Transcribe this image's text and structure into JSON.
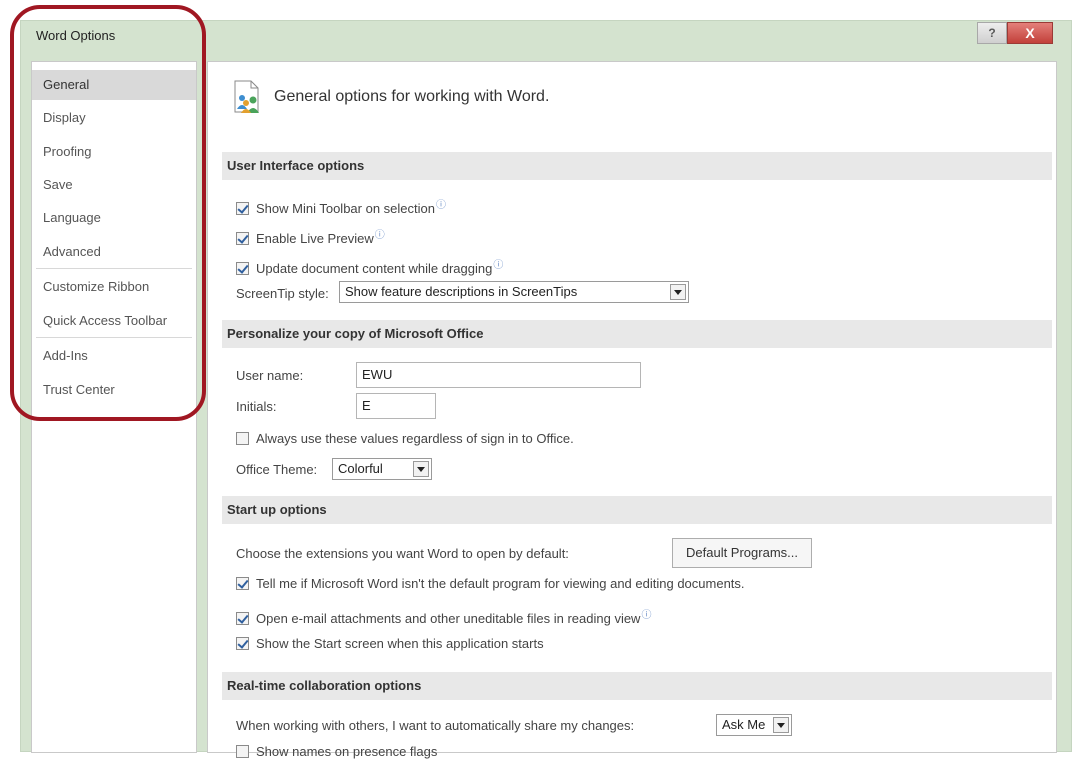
{
  "window": {
    "title": "Word Options",
    "help_glyph": "?",
    "close_glyph": "X"
  },
  "nav": {
    "items": [
      {
        "label": "General",
        "selected": true
      },
      {
        "label": "Display"
      },
      {
        "label": "Proofing"
      },
      {
        "label": "Save"
      },
      {
        "label": "Language"
      },
      {
        "label": "Advanced"
      },
      {
        "label": "Customize Ribbon"
      },
      {
        "label": "Quick Access Toolbar"
      },
      {
        "label": "Add-Ins"
      },
      {
        "label": "Trust Center"
      }
    ]
  },
  "page": {
    "title": "General options for working with Word."
  },
  "ui_options": {
    "heading": "User Interface options",
    "mini_toolbar": {
      "label": "Show Mini Toolbar on selection",
      "checked": true
    },
    "live_preview": {
      "label": "Enable Live Preview",
      "checked": true
    },
    "update_dragging": {
      "label": "Update document content while dragging",
      "checked": true
    },
    "screentip_label": "ScreenTip style:",
    "screentip_value": "Show feature descriptions in ScreenTips"
  },
  "personalize": {
    "heading": "Personalize your copy of Microsoft Office",
    "username_label": "User name:",
    "username_value": "EWU",
    "initials_label": "Initials:",
    "initials_value": "E",
    "always_use": {
      "label": "Always use these values regardless of sign in to Office.",
      "checked": false
    },
    "theme_label": "Office Theme:",
    "theme_value": "Colorful"
  },
  "startup": {
    "heading": "Start up options",
    "extensions_label": "Choose the extensions you want Word to open by default:",
    "default_programs_button": "Default Programs...",
    "tell_me": {
      "label": "Tell me if Microsoft Word isn't the default program for viewing and editing documents.",
      "checked": true
    },
    "open_email": {
      "label": "Open e-mail attachments and other uneditable files in reading view",
      "checked": true
    },
    "show_start": {
      "label": "Show the Start screen when this application starts",
      "checked": true
    }
  },
  "collab": {
    "heading": "Real-time collaboration options",
    "share_label": "When working with others, I want to automatically share my changes:",
    "share_value": "Ask Me",
    "presence": {
      "label": "Show names on presence flags",
      "checked": false
    }
  },
  "colors": {
    "highlight_ring": "#a01722",
    "titlebar": "#d4e3cf",
    "close_button": "#c2403a",
    "section_band": "#e8e8e8"
  },
  "icons": {
    "header": "general-options-people-icon",
    "info": "info-icon"
  }
}
